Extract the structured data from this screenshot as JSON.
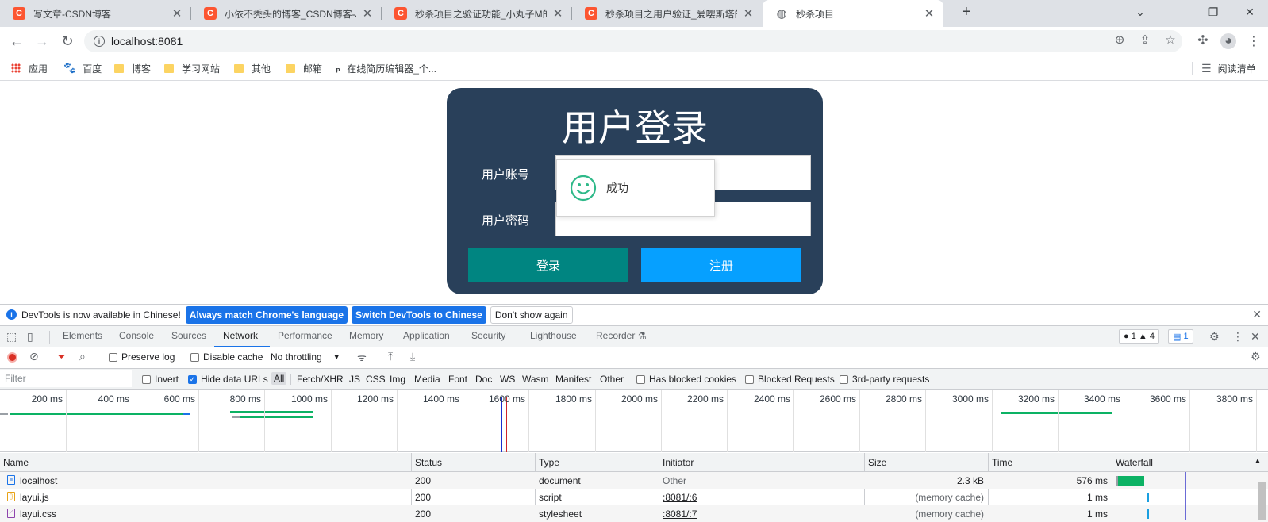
{
  "tabs": [
    {
      "title": "写文章-CSDN博客",
      "favicon": "csdn-icon"
    },
    {
      "title": "小依不秃头的博客_CSDN博客-J...",
      "favicon": "csdn-icon"
    },
    {
      "title": "秒杀项目之验证功能_小丸子M的...",
      "favicon": "csdn-icon"
    },
    {
      "title": "秒杀项目之用户验证_爱嘤斯塔的...",
      "favicon": "csdn-icon"
    },
    {
      "title": "秒杀项目",
      "favicon": "globe-icon"
    }
  ],
  "toolbar": {
    "url": "localhost:8081"
  },
  "bookmarks": [
    {
      "label": "应用",
      "icon": "apps-icon"
    },
    {
      "label": "百度",
      "icon": "baidu-icon"
    },
    {
      "label": "博客",
      "icon": "folder-icon"
    },
    {
      "label": "学习网站",
      "icon": "folder-icon"
    },
    {
      "label": "其他",
      "icon": "folder-icon"
    },
    {
      "label": "邮箱",
      "icon": "folder-icon"
    },
    {
      "label": "在线简历编辑器_个...",
      "icon": "p-icon"
    }
  ],
  "reading_list": "阅读清单",
  "login": {
    "title": "用户登录",
    "account_label": "用户账号",
    "password_label": "用户密码",
    "login_button": "登录",
    "register_button": "注册",
    "colors": {
      "panel": "#29405a",
      "login": "#009688",
      "register": "#1e9fff"
    }
  },
  "toast": {
    "message": "成功",
    "icon": "smile-icon"
  },
  "devtools": {
    "infobar": {
      "text": "DevTools is now available in Chinese!",
      "btn_match": "Always match Chrome's language",
      "btn_switch": "Switch DevTools to Chinese",
      "btn_dismiss": "Don't show again"
    },
    "tabs": [
      "Elements",
      "Console",
      "Sources",
      "Network",
      "Performance",
      "Memory",
      "Application",
      "Security",
      "Lighthouse",
      "Recorder"
    ],
    "active_tab": "Network",
    "issues": {
      "errors": "1",
      "warnings": "4",
      "messages": "1"
    },
    "network_toolbar": {
      "preserve_log": "Preserve log",
      "disable_cache": "Disable cache",
      "throttling": "No throttling"
    },
    "filter": {
      "placeholder": "Filter",
      "invert": "Invert",
      "hide_data_urls": "Hide data URLs",
      "types": [
        "All",
        "Fetch/XHR",
        "JS",
        "CSS",
        "Img",
        "Media",
        "Font",
        "Doc",
        "WS",
        "Wasm",
        "Manifest",
        "Other"
      ],
      "blocked_cookies": "Has blocked cookies",
      "blocked_requests": "Blocked Requests",
      "third_party": "3rd-party requests"
    },
    "timeline_ticks": [
      "200 ms",
      "400 ms",
      "600 ms",
      "800 ms",
      "1000 ms",
      "1200 ms",
      "1400 ms",
      "1600 ms",
      "1800 ms",
      "2000 ms",
      "2200 ms",
      "2400 ms",
      "2600 ms",
      "2800 ms",
      "3000 ms",
      "3200 ms",
      "3400 ms",
      "3600 ms",
      "3800 ms"
    ],
    "columns": [
      "Name",
      "Status",
      "Type",
      "Initiator",
      "Size",
      "Time",
      "Waterfall"
    ],
    "rows": [
      {
        "name": "localhost",
        "status": "200",
        "type": "document",
        "initiator": "Other",
        "size": "2.3 kB",
        "time": "576 ms",
        "icon": "document-icon"
      },
      {
        "name": "layui.js",
        "status": "200",
        "type": "script",
        "initiator": ":8081/:6",
        "size": "(memory cache)",
        "time": "1 ms",
        "icon": "script-icon"
      },
      {
        "name": "layui.css",
        "status": "200",
        "type": "stylesheet",
        "initiator": ":8081/:7",
        "size": "(memory cache)",
        "time": "1 ms",
        "icon": "stylesheet-icon"
      }
    ]
  }
}
